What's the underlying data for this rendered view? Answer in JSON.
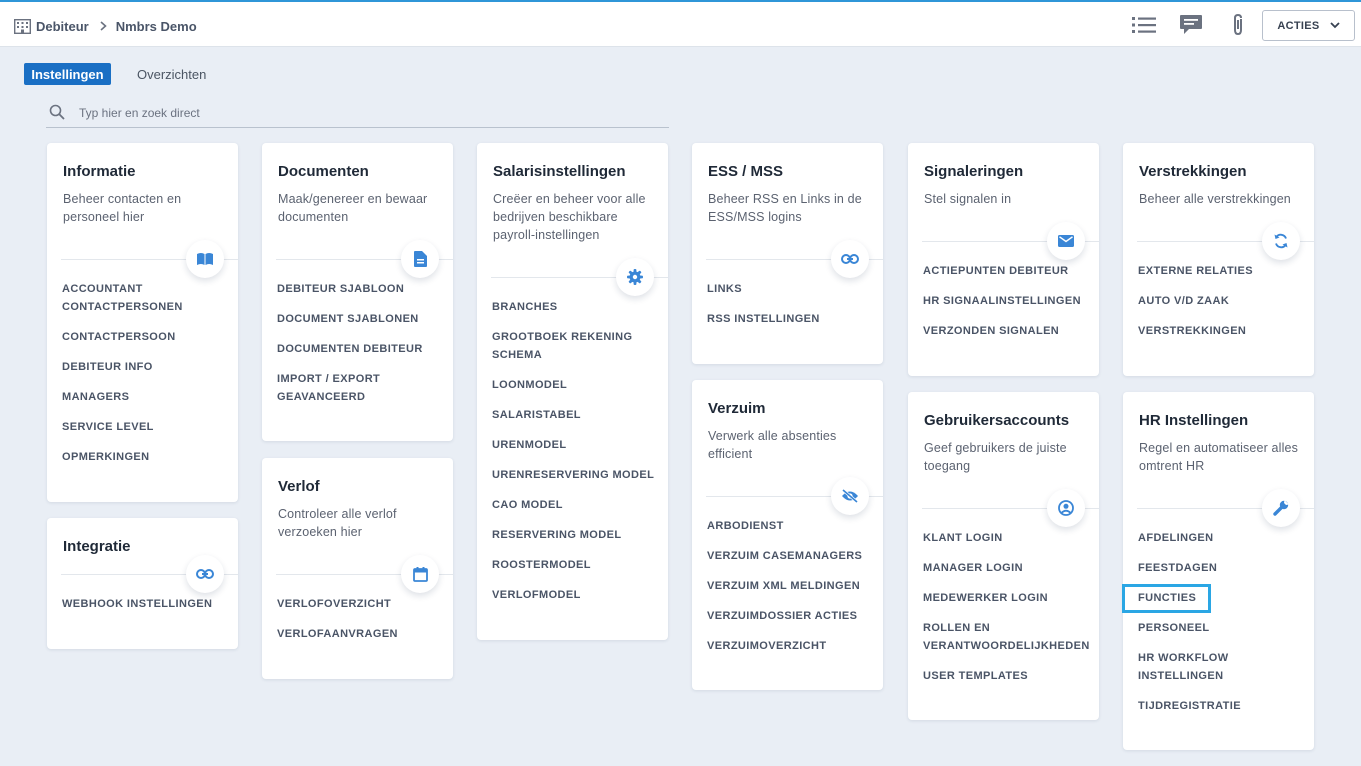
{
  "breadcrumb": {
    "parent": "Debiteur",
    "current": "Nmbrs Demo"
  },
  "toolbar": {
    "acties_label": "ACTIES"
  },
  "tabs": {
    "active": "Instellingen",
    "other": "Overzichten"
  },
  "search": {
    "placeholder": "Typ hier en zoek direct"
  },
  "colors": {
    "accent": "#1a6fc4",
    "icon": "#3a86d6",
    "highlight": "#2aa6e4",
    "background": "#e9eef5"
  },
  "cards": {
    "informatie": {
      "title": "Informatie",
      "desc": "Beheer contacten en personeel hier",
      "icon": "book-open-icon",
      "links": [
        "ACCOUNTANT CONTACTPERSONEN",
        "CONTACTPERSOON",
        "DEBITEUR INFO",
        "MANAGERS",
        "SERVICE LEVEL",
        "OPMERKINGEN"
      ]
    },
    "integratie": {
      "title": "Integratie",
      "icon": "link-icon",
      "links": [
        "WEBHOOK INSTELLINGEN"
      ]
    },
    "documenten": {
      "title": "Documenten",
      "desc": "Maak/genereer en bewaar documenten",
      "icon": "document-icon",
      "links": [
        "DEBITEUR SJABLOON",
        "DOCUMENT SJABLONEN",
        "DOCUMENTEN DEBITEUR",
        "IMPORT / EXPORT GEAVANCEERD"
      ]
    },
    "verlof": {
      "title": "Verlof",
      "desc": "Controleer alle verlof verzoeken hier",
      "icon": "calendar-icon",
      "links": [
        "VERLOFOVERZICHT",
        "VERLOFAANVRAGEN"
      ]
    },
    "salaris": {
      "title": "Salarisinstellingen",
      "desc": "Creëer en beheer voor alle bedrijven beschikbare payroll-instellingen",
      "icon": "gear-icon",
      "links": [
        "BRANCHES",
        "GROOTBOEK REKENING SCHEMA",
        "LOONMODEL",
        "SALARISTABEL",
        "URENMODEL",
        "URENRESERVERING MODEL",
        "CAO MODEL",
        "RESERVERING MODEL",
        "ROOSTERMODEL",
        "VERLOFMODEL"
      ]
    },
    "ess": {
      "title": "ESS / MSS",
      "desc": "Beheer RSS en Links in de ESS/MSS logins",
      "icon": "link-icon",
      "links": [
        "LINKS",
        "RSS INSTELLINGEN"
      ]
    },
    "verzuim": {
      "title": "Verzuim",
      "desc": "Verwerk alle absenties efficient",
      "icon": "eye-off-icon",
      "links": [
        "ARBODIENST",
        "VERZUIM CASEMANAGERS",
        "VERZUIM XML MELDINGEN",
        "VERZUIMDOSSIER ACTIES",
        "VERZUIMOVERZICHT"
      ]
    },
    "signaleringen": {
      "title": "Signaleringen",
      "desc": "Stel signalen in",
      "icon": "envelope-icon",
      "links": [
        "ACTIEPUNTEN DEBITEUR",
        "HR SIGNAALINSTELLINGEN",
        "VERZONDEN SIGNALEN"
      ]
    },
    "gebruikers": {
      "title": "Gebruikersaccounts",
      "desc": "Geef gebruikers de juiste toegang",
      "icon": "user-circle-icon",
      "links": [
        "KLANT LOGIN",
        "MANAGER LOGIN",
        "MEDEWERKER LOGIN",
        "ROLLEN EN VERANTWOORDELIJKHEDEN",
        "USER TEMPLATES"
      ]
    },
    "verstrekkingen": {
      "title": "Verstrekkingen",
      "desc": "Beheer alle verstrekkingen",
      "icon": "refresh-icon",
      "links": [
        "EXTERNE RELATIES",
        "AUTO V/D ZAAK",
        "VERSTREKKINGEN"
      ]
    },
    "hr": {
      "title": "HR Instellingen",
      "desc": "Regel en automatiseer alles omtrent HR",
      "icon": "wrench-icon",
      "links": [
        "AFDELINGEN",
        "FEESTDAGEN",
        "FUNCTIES",
        "PERSONEEL",
        "HR WORKFLOW INSTELLINGEN",
        "TIJDREGISTRATIE"
      ]
    }
  }
}
